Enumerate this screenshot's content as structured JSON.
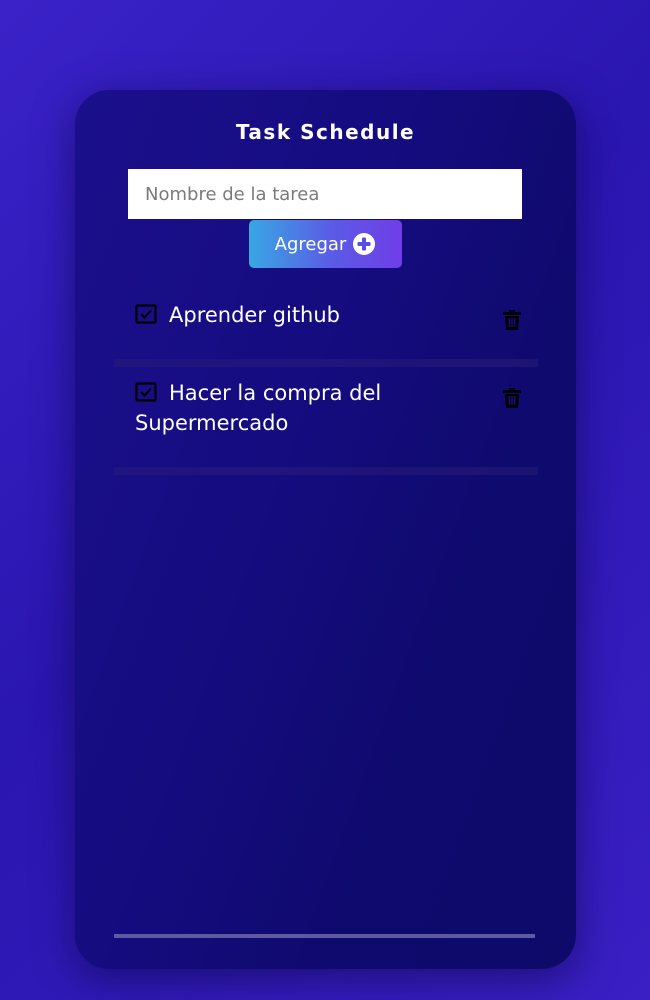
{
  "app": {
    "title": "Task Schedule"
  },
  "form": {
    "input_value": "",
    "input_placeholder": "Nombre de la tarea",
    "add_label": "Agregar"
  },
  "tasks": [
    {
      "text": "Aprender github",
      "completed": false
    },
    {
      "text": "Hacer la compra del Supermercado",
      "completed": false
    }
  ],
  "icons": {
    "add": "plus-circle-icon",
    "check": "checkbox-icon",
    "delete": "trash-icon"
  },
  "colors": {
    "background": "#2f1bbd",
    "card": "#130c7c",
    "button_start": "#38a7e3",
    "button_end": "#6f3ee8",
    "text": "#ffffff"
  }
}
